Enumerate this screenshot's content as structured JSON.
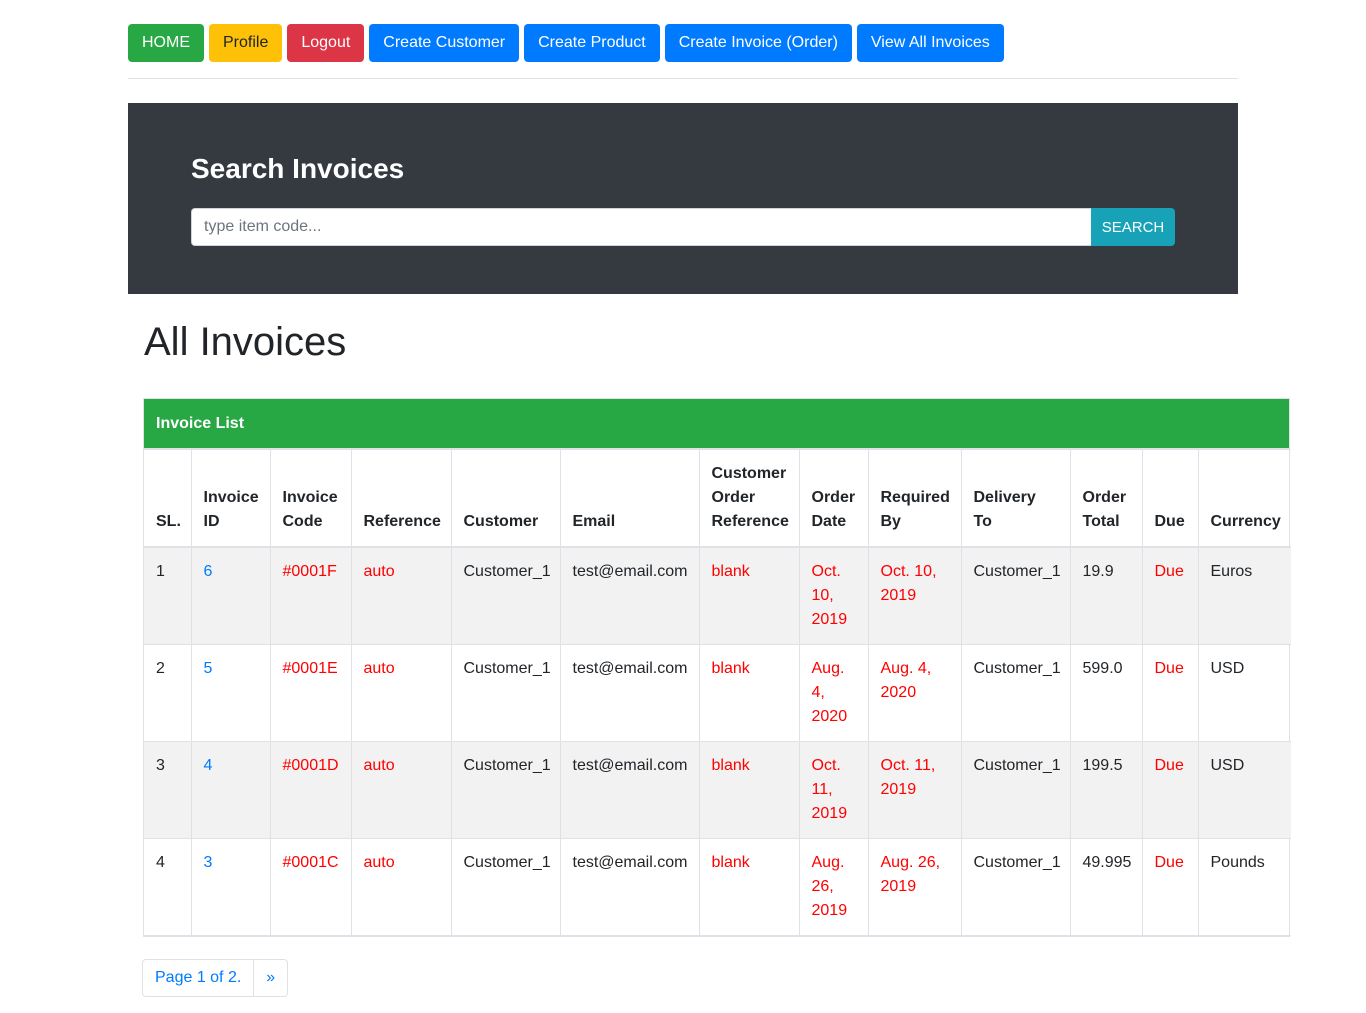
{
  "nav": {
    "home": "HOME",
    "profile": "Profile",
    "logout": "Logout",
    "create_customer": "Create Customer",
    "create_product": "Create Product",
    "create_invoice": "Create Invoice (Order)",
    "view_invoices": "View All Invoices"
  },
  "search": {
    "title": "Search Invoices",
    "placeholder": "type item code...",
    "button": "SEARCH"
  },
  "page_title": "All Invoices",
  "table": {
    "card_header": "Invoice List",
    "columns": {
      "sl": "SL.",
      "invoice_id": "Invoice ID",
      "invoice_code": "Invoice Code",
      "reference": "Reference",
      "customer": "Customer",
      "email": "Email",
      "customer_order_reference": "Customer Order Reference",
      "order_date": "Order Date",
      "required_by": "Required By",
      "delivery_to": "Delivery To",
      "order_total": "Order Total",
      "due": "Due",
      "currency": "Currency"
    },
    "rows": [
      {
        "sl": "1",
        "invoice_id": "6",
        "invoice_code": "#0001F",
        "reference": "auto",
        "customer": "Customer_1",
        "email": "test@email.com",
        "customer_order_reference": "blank",
        "order_date": "Oct. 10, 2019",
        "required_by": "Oct. 10, 2019",
        "delivery_to": "Customer_1",
        "order_total": "19.9",
        "due": "Due",
        "currency": "Euros"
      },
      {
        "sl": "2",
        "invoice_id": "5",
        "invoice_code": "#0001E",
        "reference": "auto",
        "customer": "Customer_1",
        "email": "test@email.com",
        "customer_order_reference": "blank",
        "order_date": "Aug. 4, 2020",
        "required_by": "Aug. 4, 2020",
        "delivery_to": "Customer_1",
        "order_total": "599.0",
        "due": "Due",
        "currency": "USD"
      },
      {
        "sl": "3",
        "invoice_id": "4",
        "invoice_code": "#0001D",
        "reference": "auto",
        "customer": "Customer_1",
        "email": "test@email.com",
        "customer_order_reference": "blank",
        "order_date": "Oct. 11, 2019",
        "required_by": "Oct. 11, 2019",
        "delivery_to": "Customer_1",
        "order_total": "199.5",
        "due": "Due",
        "currency": "USD"
      },
      {
        "sl": "4",
        "invoice_id": "3",
        "invoice_code": "#0001C",
        "reference": "auto",
        "customer": "Customer_1",
        "email": "test@email.com",
        "customer_order_reference": "blank",
        "order_date": "Aug. 26, 2019",
        "required_by": "Aug. 26, 2019",
        "delivery_to": "Customer_1",
        "order_total": "49.995",
        "due": "Due",
        "currency": "Pounds"
      }
    ]
  },
  "pagination": {
    "page_info": "Page 1 of 2.",
    "next": "»"
  },
  "colors": {
    "success": "#28a745",
    "warning": "#ffc107",
    "danger": "#dc3545",
    "primary": "#007bff",
    "info": "#17a2b8",
    "jumbotron": "#343a40",
    "red_text": "#ff0000"
  }
}
